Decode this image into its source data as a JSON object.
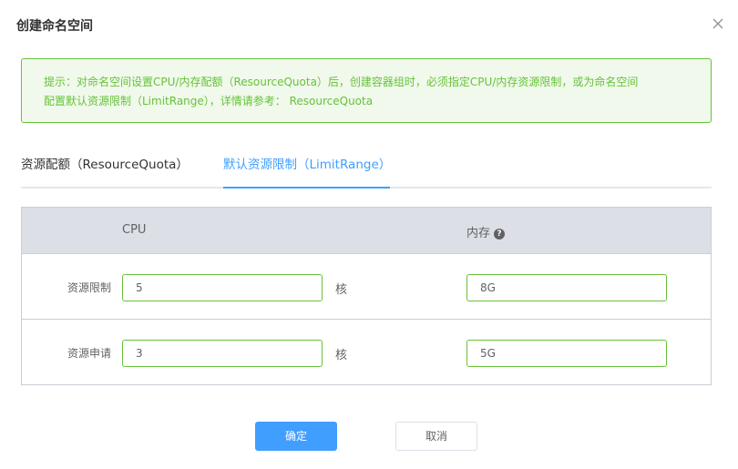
{
  "dialog": {
    "title": "创建命名空间",
    "close_icon": "close-icon"
  },
  "alert": {
    "line1": "提示：对命名空间设置CPU/内存配额（ResourceQuota）后，创建容器组时，必须指定CPU/内存资源限制，或为命名空间",
    "line2": "配置默认资源限制（LimitRange），详情请参考： ResourceQuota",
    "color": "#67c23a"
  },
  "tabs": [
    {
      "label": "资源配额（ResourceQuota）",
      "active": false
    },
    {
      "label": "默认资源限制（LimitRange）",
      "active": true
    }
  ],
  "table": {
    "headers": {
      "cpu": "CPU",
      "memory": "内存",
      "memory_help_icon": "question-circle-icon"
    },
    "rows": [
      {
        "label": "资源限制",
        "cpu": "5",
        "cpu_unit": "核",
        "memory": "8G"
      },
      {
        "label": "资源申请",
        "cpu": "3",
        "cpu_unit": "核",
        "memory": "5G"
      }
    ]
  },
  "footer": {
    "confirm_label": "确定",
    "cancel_label": "取消",
    "accent": "#409eff"
  }
}
